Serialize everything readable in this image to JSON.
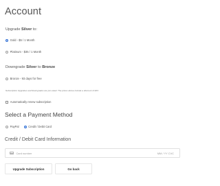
{
  "page": {
    "title": "Account"
  },
  "upgrade": {
    "heading_prefix": "Upgrade ",
    "heading_plan": "Silver",
    "heading_suffix": " to:",
    "options": [
      {
        "label": "Gold - $5 / 1 Month",
        "selected": true
      },
      {
        "label": "Platinum - $35 / 1 Month",
        "selected": false
      }
    ]
  },
  "downgrade": {
    "heading_prefix": "Downgrade ",
    "heading_from": "Silver",
    "heading_mid": " to ",
    "heading_to": "Bronze",
    "options": [
      {
        "label": "Bronze - 93 days for free",
        "selected": false
      }
    ]
  },
  "fineprint": "Subscription Upgrades and Downgrades are pro-rated. The prices above include a discount of $33.",
  "auto_renew": {
    "label": "Automatically renew subscription",
    "checked": false
  },
  "payment": {
    "title": "Select a Payment Method",
    "options": [
      {
        "label": "PayPal",
        "selected": false
      },
      {
        "label": "Credit / Debit Card",
        "selected": true
      }
    ]
  },
  "card": {
    "title": "Credit / Debit Card Information",
    "number_placeholder": "Card number",
    "expiry_cvc_placeholder": "MM / YY  CVC"
  },
  "actions": {
    "upgrade_label": "Upgrade Subscription",
    "back_label": "Go back"
  },
  "colors": {
    "accent": "#2f6fd6",
    "border": "#e0e0e0"
  }
}
